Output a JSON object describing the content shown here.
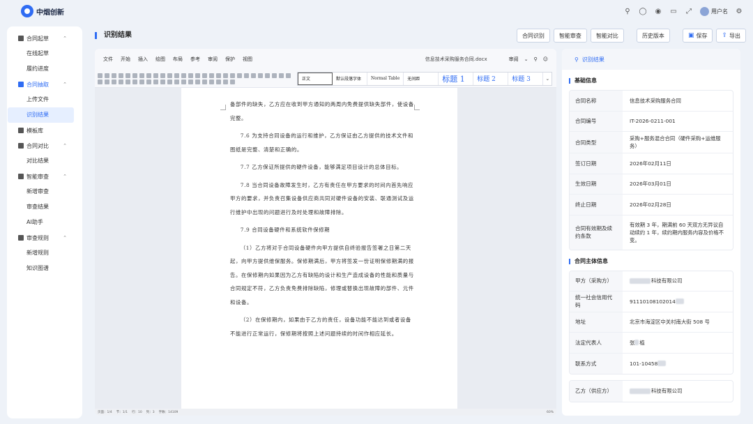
{
  "app": {
    "logo_text": "中烟创新",
    "username": "用户名"
  },
  "sidebar": {
    "groups": [
      {
        "label": "合同起草",
        "items": [
          "在线起草",
          "履约进度"
        ]
      },
      {
        "label": "合同抽取",
        "items": [
          "上传文件",
          "识别结果"
        ]
      },
      {
        "label": "模板库",
        "items": []
      },
      {
        "label": "合同对比",
        "items": [
          "对比结果"
        ]
      },
      {
        "label": "智能审查",
        "items": [
          "新增审查",
          "审查结果",
          "AI助手"
        ]
      },
      {
        "label": "审查规则",
        "items": [
          "新增规则",
          "知识图谱"
        ]
      }
    ]
  },
  "header": {
    "title": "识别结果",
    "buttons": [
      "合同识别",
      "智能审查",
      "智能对比",
      "历史版本"
    ],
    "save": "保存",
    "export": "导出"
  },
  "editor": {
    "menus": [
      "文件",
      "开始",
      "插入",
      "绘图",
      "布局",
      "参考",
      "审阅",
      "保护",
      "视图"
    ],
    "filename": "信息技术采购服务合同.docx",
    "review": "审阅",
    "styles": [
      "正文",
      "默认段落字体",
      "Normal Table",
      "无间距",
      "标题 1",
      "标题 2",
      "标题 3"
    ],
    "paragraphs": [
      "备部件的缺失，乙方应在收到甲方通知的两周内免费提供缺失部件，使设备完整。",
      "7.6 为支持合同设备的运行和维护，乙方保证由乙方提供的技术文件和图纸是完整、清楚和正确的。",
      "7.7 乙方保证所提供的硬件设备，能够满足项目设计的总体目标。",
      "7.8 当合同设备故障发生时，乙方有责任在甲方要求的时间内首先响应甲方的要求，并负责召集设备供应商共同对硬件设备的安装、联通测试及运行维护中出现的问题进行及时处理和故障排除。",
      "7.9 合同设备硬件和系统软件保修期",
      "（1）乙方将对于合同设备硬件向甲方提供自终验报告签署之日第二天起，向甲方提供维保服务。保修期满后，甲方将签发一份证明保修期满的报告。在保修期内如果因为乙方有缺陷的设计和生产造成设备的性能和质量与合同规定不符，乙方负责免费排除缺陷，修理或替换出现故障的部件、元件和设备。",
      "（2）在保修期内，如果由于乙方的责任，设备功能不能达到或者设备不能进行正常运行，保修期将按照上述问题持续的时间作相应延长。"
    ],
    "status_left": [
      "页面：1/4",
      "节：1/1",
      "行：10",
      "列：3",
      "字数：14109"
    ],
    "status_right": [
      "60%"
    ]
  },
  "panel": {
    "tab": "识别结果",
    "basic_title": "基础信息",
    "basic": [
      {
        "k": "合同名称",
        "v": "信息技术采购服务合同"
      },
      {
        "k": "合同编号",
        "v": "IT-2026-0211-001"
      },
      {
        "k": "合同类型",
        "v": "采购+服务混合合同（硬件采购+运维服务）"
      },
      {
        "k": "签订日期",
        "v": "2026年02月11日"
      },
      {
        "k": "生效日期",
        "v": "2026年03月01日"
      },
      {
        "k": "终止日期",
        "v": "2026年02月28日"
      },
      {
        "k": "合同有效期及续约条款",
        "v": "有效期 3 年，期满前 60 天双方无异议自动续约 1 年，续约期内服务内容及价格不变。"
      }
    ],
    "party_title": "合同主体信息",
    "party_a": [
      {
        "k": "甲方（采购方）",
        "v": "科技有限公司"
      },
      {
        "k": "统一社会信用代码",
        "v": "91110108102014"
      },
      {
        "k": "地址",
        "v": "北京市海淀区中关村南大街 508 号"
      },
      {
        "k": "法定代表人",
        "v1": "张",
        "v2": "植"
      },
      {
        "k": "联系方式",
        "v": "101-10458"
      }
    ],
    "party_b": [
      {
        "k": "乙方（供应方）",
        "v": "科技有限公司"
      }
    ]
  }
}
